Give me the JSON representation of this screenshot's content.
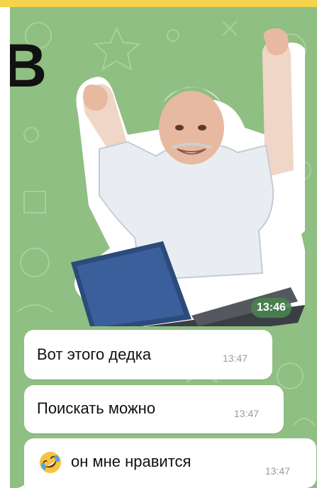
{
  "edge_fragment": "В",
  "sticker": {
    "time": "13:46"
  },
  "messages": [
    {
      "text": "Вот этого дедка",
      "time": "13:47"
    },
    {
      "text": "Поискать можно",
      "time": "13:47"
    },
    {
      "emoji": "rolling-on-floor-laughing-emoji",
      "text": "он мне нравится",
      "time": "13:47"
    }
  ],
  "colors": {
    "chat_background": "#8fbf82",
    "bubble": "#ffffff",
    "top_strip": "#f5d34a",
    "sticker_time_badge": "#4a824e"
  }
}
